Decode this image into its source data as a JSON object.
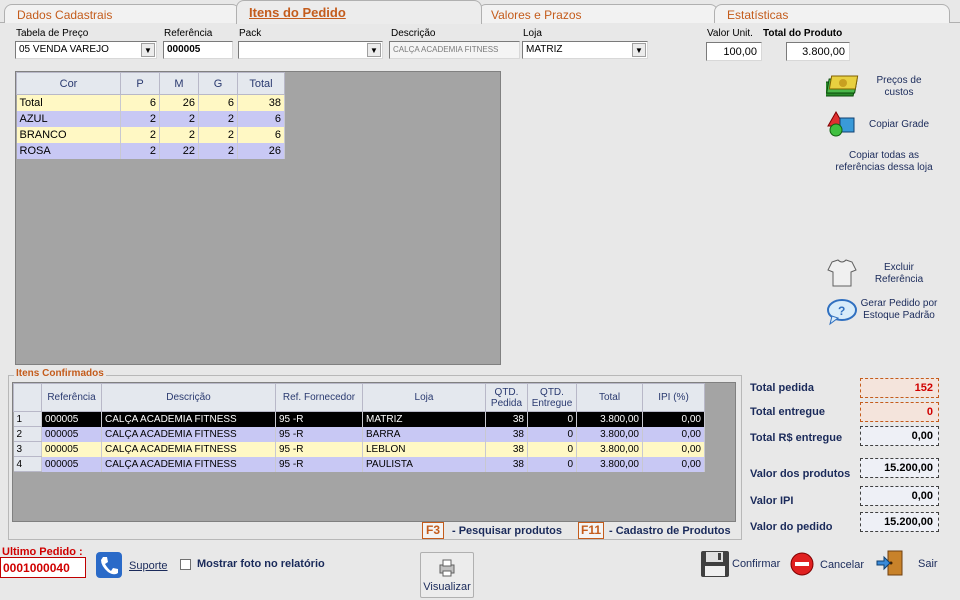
{
  "tabs": [
    "Dados Cadastrais",
    "Itens do Pedido",
    "Valores e Prazos",
    "Estatísticas"
  ],
  "header": {
    "tabela_label": "Tabela de Preço",
    "tabela_value": "05 VENDA VAREJO",
    "referencia_label": "Referência",
    "referencia_value": "000005",
    "pack_label": "Pack",
    "pack_value": "",
    "descricao_label": "Descrição",
    "descricao_value": "CALÇA ACADEMIA FITNESS",
    "loja_label": "Loja",
    "loja_value": "MATRIZ",
    "valor_unit_label": "Valor Unit.",
    "valor_unit_value": "100,00",
    "total_produto_label": "Total do Produto",
    "total_produto_value": "3.800,00"
  },
  "size_grid": {
    "columns": [
      "Cor",
      "P",
      "M",
      "G",
      "Total"
    ],
    "rows": [
      {
        "cor": "Total",
        "p": "6",
        "m": "26",
        "g": "6",
        "total": "38",
        "bg": "#fff8c4"
      },
      {
        "cor": "AZUL",
        "p": "2",
        "m": "2",
        "g": "2",
        "total": "6",
        "bg": "#c8c8f4"
      },
      {
        "cor": "BRANCO",
        "p": "2",
        "m": "2",
        "g": "2",
        "total": "6",
        "bg": "#fff8c4"
      },
      {
        "cor": "ROSA",
        "p": "2",
        "m": "22",
        "g": "2",
        "total": "26",
        "bg": "#c8c8f4"
      }
    ]
  },
  "side_actions": {
    "precos": "Preços de custos",
    "copiar_grade": "Copiar Grade",
    "copiar_todas": "Copiar todas as referências dessa loja",
    "excluir": "Excluir Referência",
    "gerar": "Gerar Pedido por Estoque Padrão"
  },
  "confirmed": {
    "title": "Itens Confirmados",
    "columns": [
      "Referência",
      "Descrição",
      "Ref. Fornecedor",
      "Loja",
      "QTD. Pedida",
      "QTD. Entregue",
      "Total",
      "IPI (%)"
    ],
    "rows": [
      {
        "n": "1",
        "ref": "000005",
        "desc": "CALÇA ACADEMIA FITNESS",
        "forn": "95 -R",
        "loja": "MATRIZ",
        "qp": "38",
        "qe": "0",
        "total": "3.800,00",
        "ipi": "0,00"
      },
      {
        "n": "2",
        "ref": "000005",
        "desc": "CALÇA ACADEMIA FITNESS",
        "forn": "95 -R",
        "loja": "BARRA",
        "qp": "38",
        "qe": "0",
        "total": "3.800,00",
        "ipi": "0,00"
      },
      {
        "n": "3",
        "ref": "000005",
        "desc": "CALÇA ACADEMIA FITNESS",
        "forn": "95 -R",
        "loja": "LEBLON",
        "qp": "38",
        "qe": "0",
        "total": "3.800,00",
        "ipi": "0,00"
      },
      {
        "n": "4",
        "ref": "000005",
        "desc": "CALÇA ACADEMIA FITNESS",
        "forn": "95 -R",
        "loja": "PAULISTA",
        "qp": "38",
        "qe": "0",
        "total": "3.800,00",
        "ipi": "0,00"
      }
    ],
    "row_colors": [
      "#000000",
      "#c8c8f4",
      "#fff8c4",
      "#c8c8f4"
    ]
  },
  "totals": {
    "total_pedida_label": "Total pedida",
    "total_pedida": "152",
    "total_entregue_label": "Total entregue",
    "total_entregue": "0",
    "total_rs_label": "Total R$ entregue",
    "total_rs": "0,00",
    "valor_produtos_label": "Valor dos produtos",
    "valor_produtos": "15.200,00",
    "valor_ipi_label": "Valor IPI",
    "valor_ipi": "0,00",
    "valor_pedido_label": "Valor do pedido",
    "valor_pedido": "15.200,00"
  },
  "shortcuts": {
    "f3_key": "F3",
    "f3_desc": "- Pesquisar produtos",
    "f11_key": "F11",
    "f11_desc": "- Cadastro de Produtos"
  },
  "footer": {
    "ultimo_label": "Ultimo Pedido :",
    "ultimo_value": "0001000040",
    "suporte": "Suporte",
    "mostrar_foto": "Mostrar foto no relatório",
    "visualizar": "Visualizar",
    "confirmar": "Confirmar",
    "cancelar": "Cancelar",
    "sair": "Sair"
  }
}
